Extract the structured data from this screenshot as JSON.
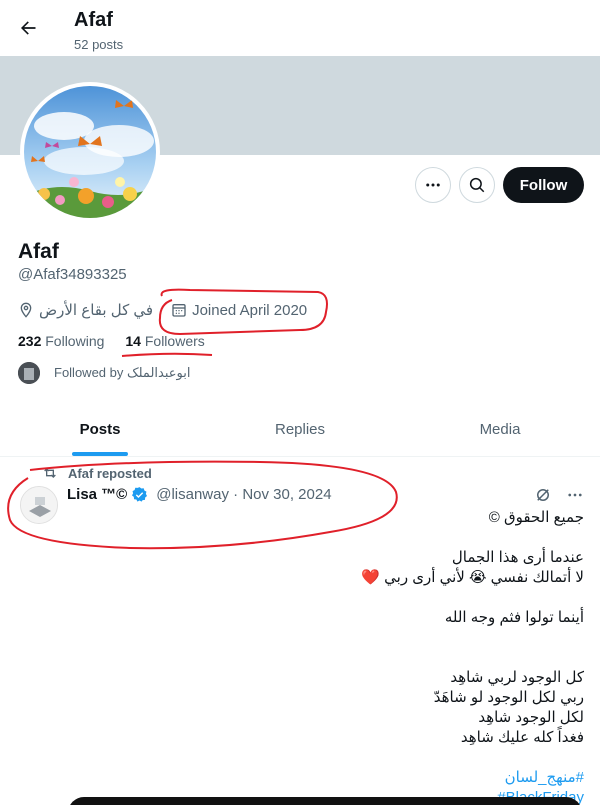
{
  "header": {
    "title": "Afaf",
    "posts_count": "52 posts"
  },
  "profile": {
    "display_name": "Afaf",
    "handle": "@Afaf34893325",
    "location": "في كل بقاع الأرض",
    "joined": "Joined April 2020",
    "following_count": "232",
    "following_label": "Following",
    "followers_count": "14",
    "followers_label": "Followers",
    "followed_by": "Followed by ابوعبدالملک"
  },
  "actions": {
    "follow_label": "Follow"
  },
  "tabs": [
    {
      "label": "Posts",
      "active": true
    },
    {
      "label": "Replies",
      "active": false
    },
    {
      "label": "Media",
      "active": false
    }
  ],
  "post": {
    "repost_label": "Afaf reposted",
    "author": "Lisa ™©",
    "handle_date": "@lisanway · Nov 30, 2024",
    "lines": [
      "جميع الحقوق ©",
      "",
      "عندما أرى هذا الجمال",
      "لا أتمالك نفسي 😭 لأني أرى ربي ❤️",
      "",
      "أينما تولوا فثم وجه الله",
      "",
      "كل الوجود لربي شاهِد",
      "ربي لكل الوجود لو شاهَدّ",
      "لكل الوجود شاهِد",
      "فغداً كله عليك شاهِد",
      ""
    ],
    "hashtags": [
      "#منهج_لسان",
      "#BlackFriday"
    ]
  },
  "colors": {
    "accent": "#1d9bf0",
    "annotation": "#e0202a",
    "follow_button": "#0f1419"
  }
}
